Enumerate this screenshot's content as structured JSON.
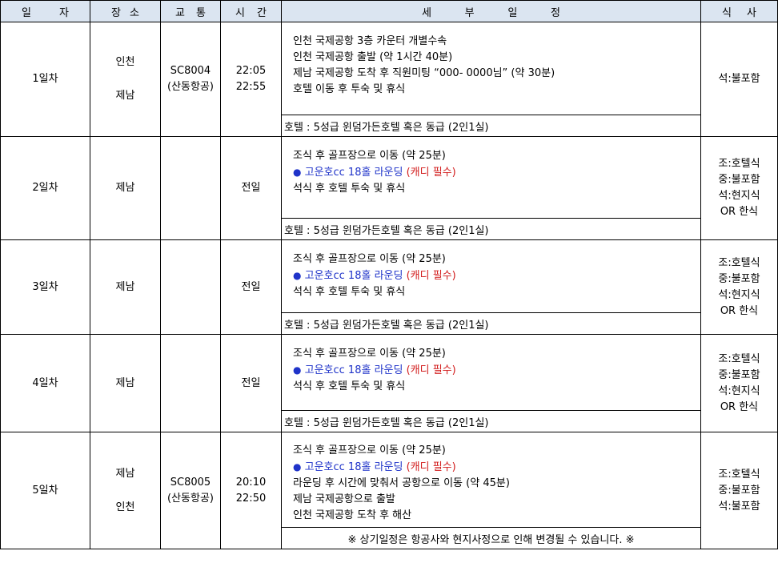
{
  "header": {
    "day": [
      "일",
      "자"
    ],
    "place": [
      "장",
      "소"
    ],
    "transport": [
      "교",
      "통"
    ],
    "time": [
      "시",
      "간"
    ],
    "schedule": [
      "세",
      "부",
      "일",
      "정"
    ],
    "meal": [
      "식",
      "사"
    ]
  },
  "days": [
    {
      "day": "1일차",
      "places": [
        "인천",
        "제남"
      ],
      "flight": [
        "SC8004",
        "(산동항공)"
      ],
      "time": [
        "22:05",
        "22:55"
      ],
      "schedule": [
        "인천 국제공항 3층 카운터 개별수속",
        "인천 국제공항 출발 (약 1시간 40분)",
        "제남 국제공항 도착 후 직원미팅 “000- 0000님” (약 30분)",
        "호텔 이동 후 투숙 및 휴식"
      ],
      "hotel": "호텔 : 5성급 윈덤가든호텔 혹은 동급 (2인1실)",
      "meals": [
        "석:불포함"
      ]
    },
    {
      "day": "2일차",
      "places": [
        "제남"
      ],
      "time": [
        "전일"
      ],
      "schedule_pre": "조식 후 골프장으로 이동 (약 25분)",
      "round_bullet": "●",
      "round_text": "고운호cc 18홀 라운딩",
      "caddy": "(캐디 필수)",
      "schedule_post": [
        "석식 후 호텔 투숙 및 휴식"
      ],
      "hotel": "호텔 : 5성급 윈덤가든호텔 혹은 동급 (2인1실)",
      "meals": [
        "조:호텔식",
        "중:불포함",
        "석:현지식",
        "OR 한식"
      ]
    },
    {
      "day": "3일차",
      "places": [
        "제남"
      ],
      "time": [
        "전일"
      ],
      "schedule_pre": "조식 후 골프장으로 이동 (약 25분)",
      "round_bullet": "●",
      "round_text": "고운호cc 18홀 라운딩",
      "caddy": "(캐디 필수)",
      "schedule_post": [
        "석식 후 호텔 투숙 및 휴식"
      ],
      "hotel": "호텔 : 5성급 윈덤가든호텔 혹은 동급 (2인1실)",
      "meals": [
        "조:호텔식",
        "중:불포함",
        "석:현지식",
        "OR 한식"
      ]
    },
    {
      "day": "4일차",
      "places": [
        "제남"
      ],
      "time": [
        "전일"
      ],
      "schedule_pre": "조식 후 골프장으로 이동 (약 25분)",
      "round_bullet": "●",
      "round_text": "고운호cc 18홀 라운딩",
      "caddy": "(캐디 필수)",
      "schedule_post": [
        "석식 후 호텔 투숙 및 휴식"
      ],
      "hotel": "호텔 : 5성급 윈덤가든호텔 혹은 동급 (2인1실)",
      "meals": [
        "조:호텔식",
        "중:불포함",
        "석:현지식",
        "OR 한식"
      ]
    },
    {
      "day": "5일차",
      "places": [
        "제남",
        "인천"
      ],
      "flight": [
        "SC8005",
        "(산동항공)"
      ],
      "time": [
        "20:10",
        "22:50"
      ],
      "schedule_pre": "조식 후 골프장으로 이동 (약 25분)",
      "round_bullet": "●",
      "round_text": "고운호cc 18홀 라운딩",
      "caddy": "(캐디 필수)",
      "schedule_post": [
        "라운딩 후 시간에 맞춰서 공항으로 이동 (약 45분)",
        "제남 국제공항으로 출발",
        "인천 국제공항 도착 후 해산"
      ],
      "notice": "※ 상기일정은 항공사와 현지사정으로 인해 변경될 수 있습니다. ※",
      "meals": [
        "조:호텔식",
        "중:불포함",
        "석:불포함"
      ]
    }
  ]
}
